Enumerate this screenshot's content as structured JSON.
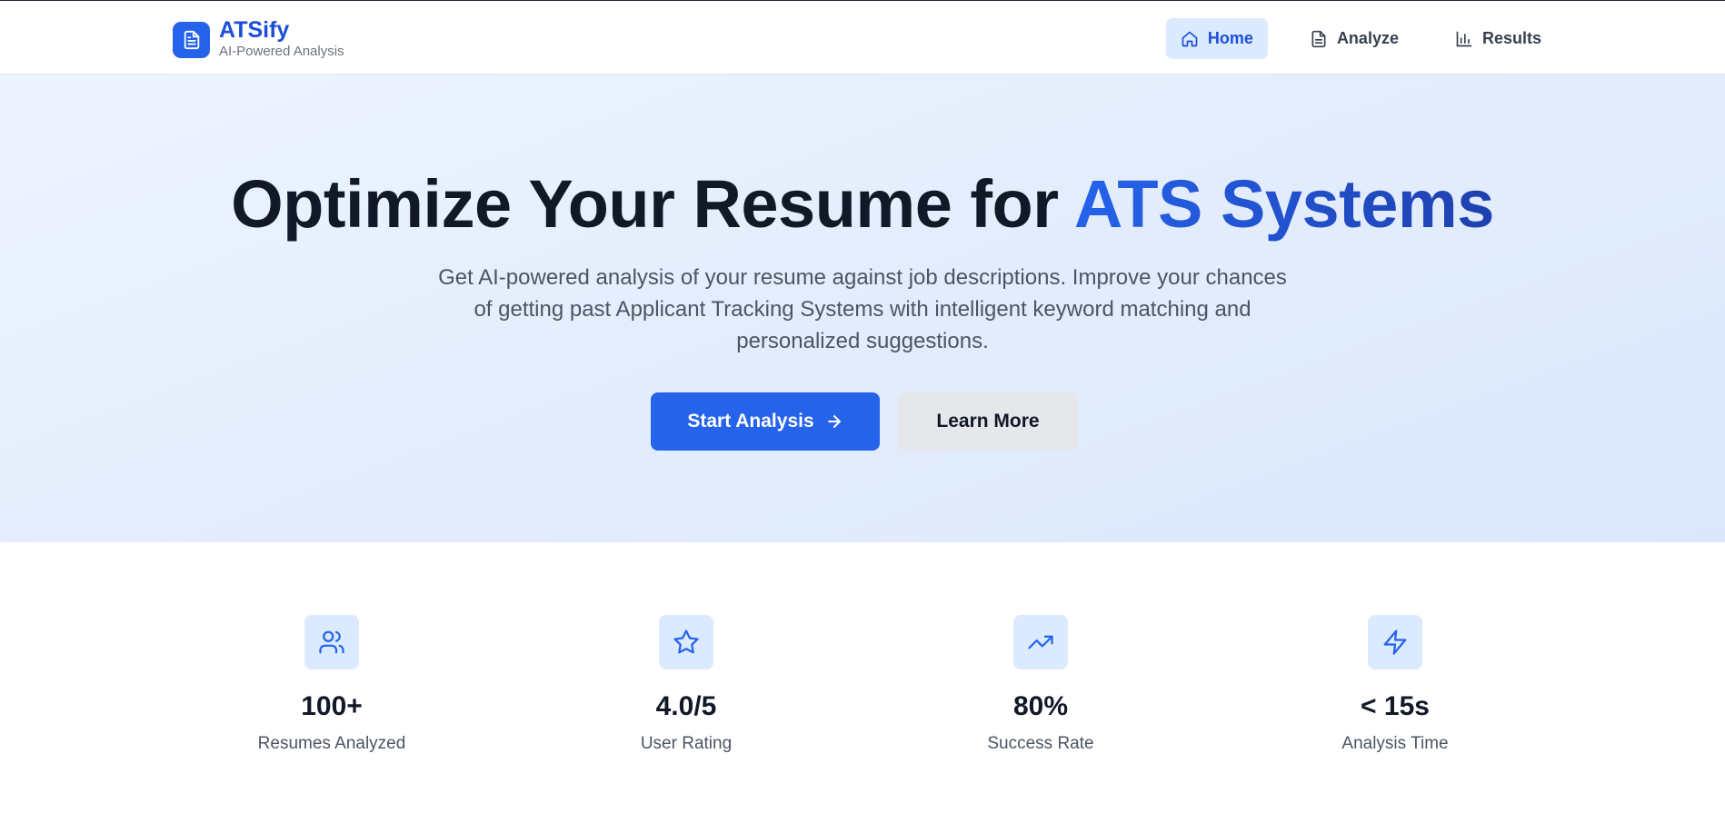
{
  "brand": {
    "name": "ATSify",
    "subtitle": "AI-Powered Analysis",
    "icon": "document-icon"
  },
  "nav": {
    "items": [
      {
        "label": "Home",
        "icon": "home-icon",
        "active": true
      },
      {
        "label": "Analyze",
        "icon": "document-icon",
        "active": false
      },
      {
        "label": "Results",
        "icon": "bar-chart-icon",
        "active": false
      }
    ]
  },
  "hero": {
    "title_prefix": "Optimize Your Resume for ",
    "title_accent": "ATS Systems",
    "description": "Get AI-powered analysis of your resume against job descriptions. Improve your chances of getting past Applicant Tracking Systems with intelligent keyword matching and personalized suggestions.",
    "primary_button": "Start Analysis",
    "secondary_button": "Learn More"
  },
  "stats": [
    {
      "value": "100+",
      "label": "Resumes Analyzed",
      "icon": "users-icon"
    },
    {
      "value": "4.0/5",
      "label": "User Rating",
      "icon": "star-icon"
    },
    {
      "value": "80%",
      "label": "Success Rate",
      "icon": "trending-up-icon"
    },
    {
      "value": "< 15s",
      "label": "Analysis Time",
      "icon": "zap-icon"
    }
  ],
  "colors": {
    "accent": "#2563eb",
    "accent_dark": "#1d4ed8",
    "accent_light": "#dbeafe",
    "secondary_button": "#e5e7eb"
  }
}
